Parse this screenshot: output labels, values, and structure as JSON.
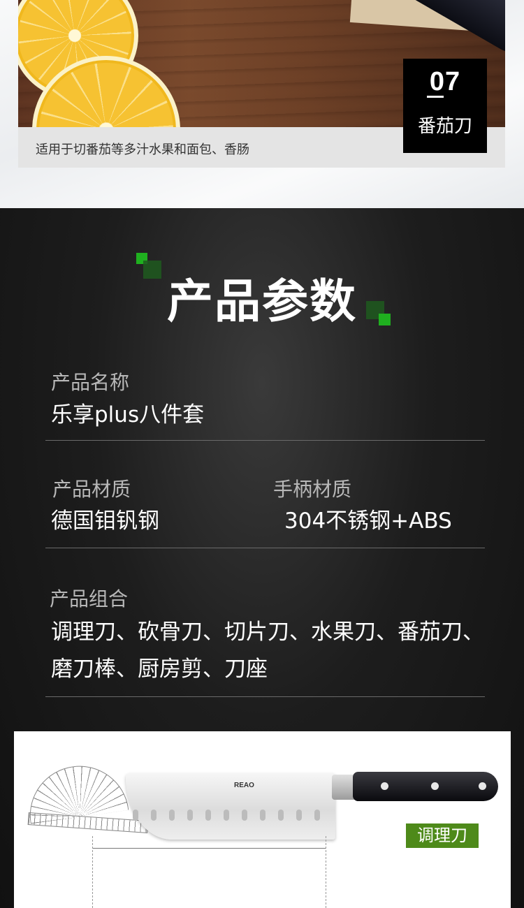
{
  "photo_section": {
    "badge_number": "07",
    "badge_name": "番茄刀",
    "caption": "适用于切番茄等多汁水果和面包、香肠"
  },
  "params": {
    "heading": "产品参数",
    "name_label": "产品名称",
    "name_value": "乐享plus八件套",
    "material_label": "产品材质",
    "material_value": "德国钼钒钢",
    "handle_label": "手柄材质",
    "handle_value": "304不锈钢+ABS",
    "combo_label": "产品组合",
    "combo_line1": "调理刀、砍骨刀、切片刀、水果刀、番茄刀、",
    "combo_line2": "磨刀棒、厨房剪、刀座"
  },
  "product_card": {
    "blade_brand": "REAO",
    "tag": "调理刀"
  },
  "colors": {
    "accent_green": "#4e8a1a",
    "bright_green": "#1fb01f",
    "dark_bg": "#1d1d1d"
  }
}
